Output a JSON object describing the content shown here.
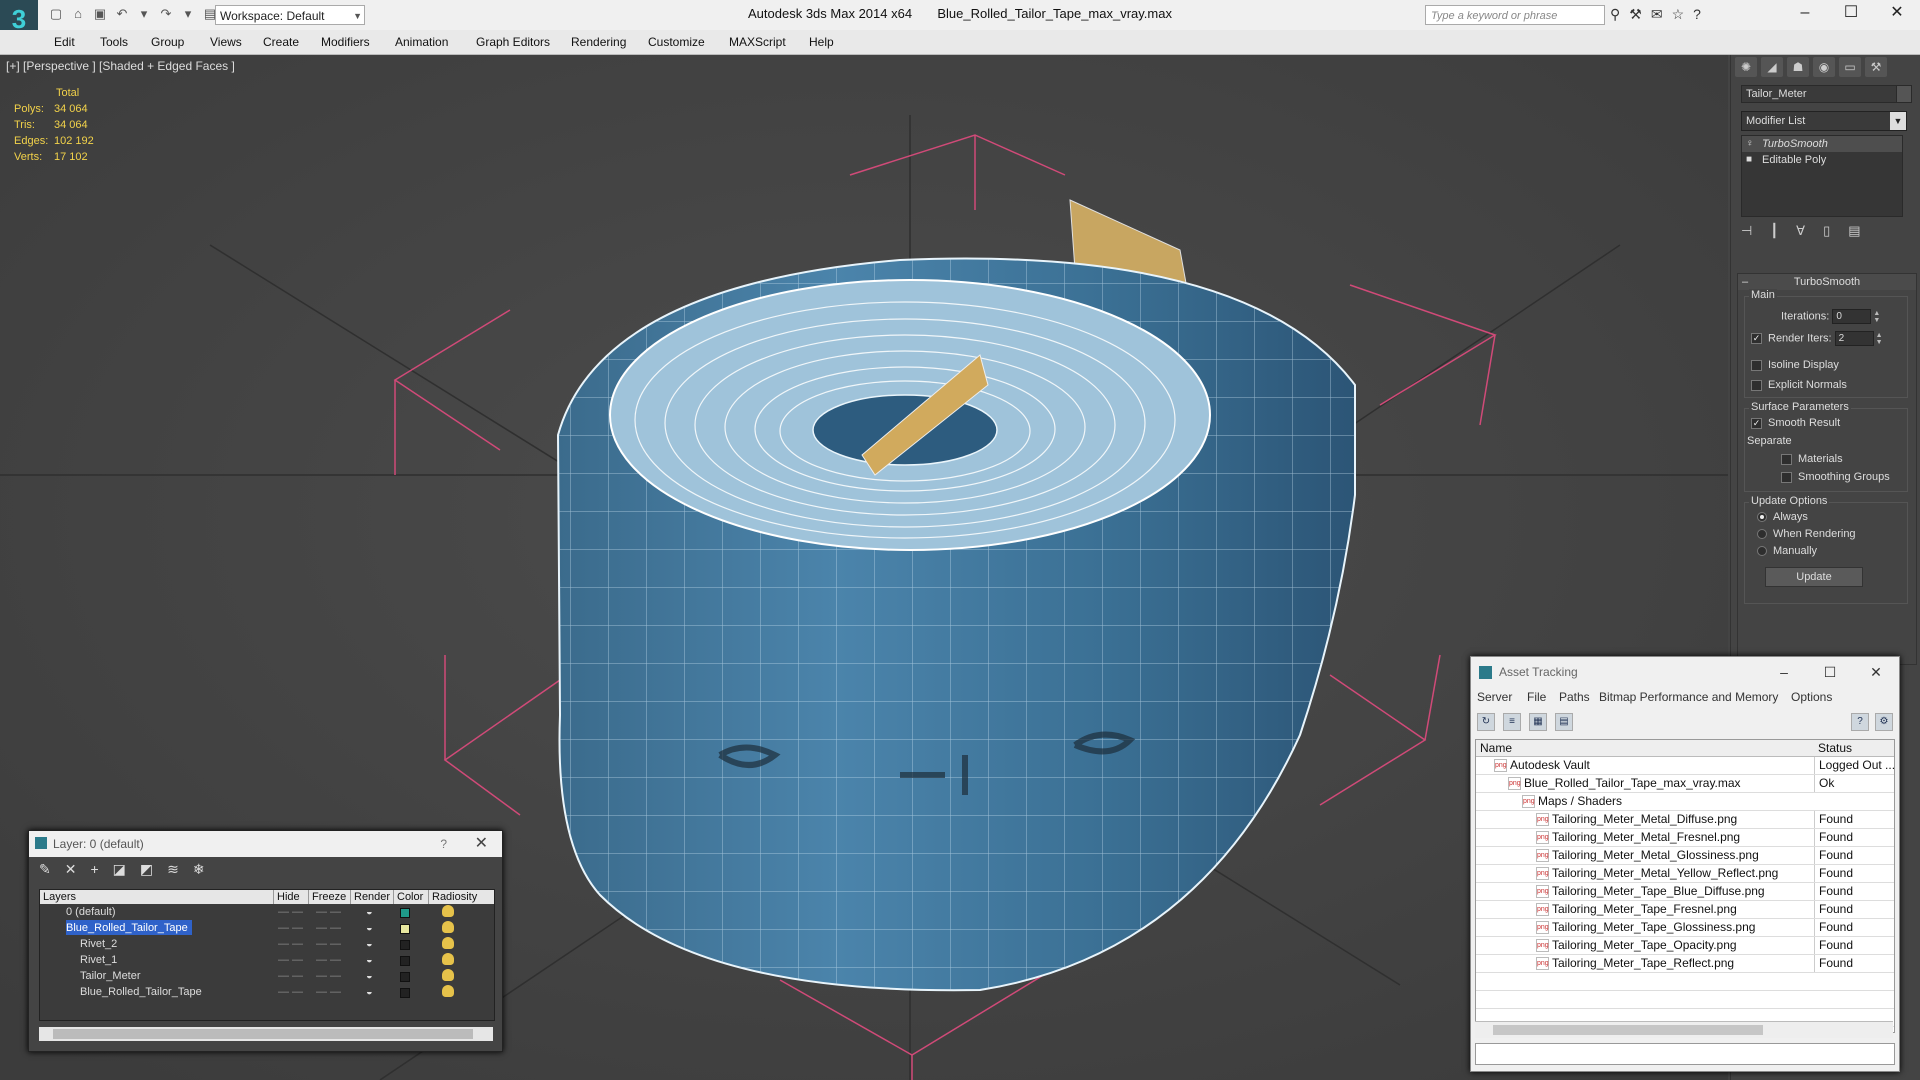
{
  "app": {
    "window_title": "Autodesk 3ds Max  2014 x64",
    "file_title": "Blue_Rolled_Tailor_Tape_max_vray.max",
    "workspace": "Workspace: Default",
    "search_placeholder": "Type a keyword or phrase",
    "logo": "3"
  },
  "menu": [
    "Edit",
    "Tools",
    "Group",
    "Views",
    "Create",
    "Modifiers",
    "Animation",
    "Graph Editors",
    "Rendering",
    "Customize",
    "MAXScript",
    "Help"
  ],
  "viewport": {
    "label": "[+] [Perspective ] [Shaded + Edged Faces ]",
    "stats": {
      "header": "Total",
      "rows": [
        {
          "label": "Polys:",
          "value": "34 064"
        },
        {
          "label": "Tris:",
          "value": "34 064"
        },
        {
          "label": "Edges:",
          "value": "102 192"
        },
        {
          "label": "Verts:",
          "value": "17 102"
        }
      ]
    }
  },
  "command_panel": {
    "object_name": "Tailor_Meter",
    "modifier_list": "Modifier List",
    "stack": [
      "TurboSmooth",
      "Editable Poly"
    ],
    "rollout_title": "TurboSmooth",
    "main_label": "Main",
    "iterations_label": "Iterations:",
    "iterations_value": "0",
    "render_iters_label": "Render Iters:",
    "render_iters_value": "2",
    "isoline": "Isoline Display",
    "explicit": "Explicit Normals",
    "surface_params": "Surface Parameters",
    "smooth_result": "Smooth Result",
    "separate": "Separate",
    "materials": "Materials",
    "smoothing_groups": "Smoothing Groups",
    "update_options": "Update Options",
    "always": "Always",
    "when_rendering": "When Rendering",
    "manually": "Manually",
    "update_button": "Update"
  },
  "layer_window": {
    "title": "Layer: 0 (default)",
    "help": "?",
    "columns": [
      "Layers",
      "Hide",
      "Freeze",
      "Render",
      "Color",
      "Radiosity"
    ],
    "rows": [
      {
        "name": "0 (default)",
        "indent": 0,
        "color": "#1f9a8a",
        "selected": false
      },
      {
        "name": "Blue_Rolled_Tailor_Tape",
        "indent": 0,
        "color": "#e8e8a0",
        "selected": true
      },
      {
        "name": "Rivet_2",
        "indent": 1,
        "color": "#222222",
        "selected": false
      },
      {
        "name": "Rivet_1",
        "indent": 1,
        "color": "#222222",
        "selected": false
      },
      {
        "name": "Tailor_Meter",
        "indent": 1,
        "color": "#222222",
        "selected": false
      },
      {
        "name": "Blue_Rolled_Tailor_Tape",
        "indent": 1,
        "color": "#222222",
        "selected": false
      }
    ]
  },
  "asset_window": {
    "title": "Asset Tracking",
    "menu": [
      "Server",
      "File",
      "Paths",
      "Bitmap Performance and Memory",
      "Options"
    ],
    "columns": [
      "Name",
      "Status"
    ],
    "rows": [
      {
        "name": "Autodesk Vault",
        "status": "Logged Out ...",
        "indent": 1
      },
      {
        "name": "Blue_Rolled_Tailor_Tape_max_vray.max",
        "status": "Ok",
        "indent": 2
      },
      {
        "name": "Maps / Shaders",
        "status": "",
        "indent": 3
      },
      {
        "name": "Tailoring_Meter_Metal_Diffuse.png",
        "status": "Found",
        "indent": 4
      },
      {
        "name": "Tailoring_Meter_Metal_Fresnel.png",
        "status": "Found",
        "indent": 4
      },
      {
        "name": "Tailoring_Meter_Metal_Glossiness.png",
        "status": "Found",
        "indent": 4
      },
      {
        "name": "Tailoring_Meter_Metal_Yellow_Reflect.png",
        "status": "Found",
        "indent": 4
      },
      {
        "name": "Tailoring_Meter_Tape_Blue_Diffuse.png",
        "status": "Found",
        "indent": 4
      },
      {
        "name": "Tailoring_Meter_Tape_Fresnel.png",
        "status": "Found",
        "indent": 4
      },
      {
        "name": "Tailoring_Meter_Tape_Glossiness.png",
        "status": "Found",
        "indent": 4
      },
      {
        "name": "Tailoring_Meter_Tape_Opacity.png",
        "status": "Found",
        "indent": 4
      },
      {
        "name": "Tailoring_Meter_Tape_Reflect.png",
        "status": "Found",
        "indent": 4
      }
    ]
  }
}
